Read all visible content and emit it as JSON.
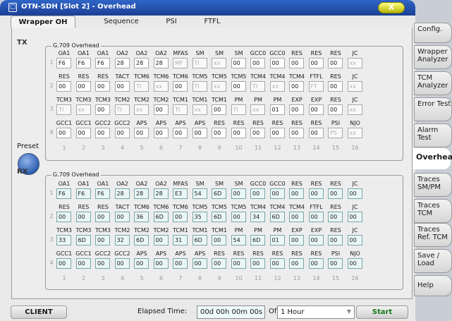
{
  "window": {
    "title": "OTN-SDH [Slot 2] - Overhead",
    "icon": "app-window-icon",
    "close_label": "X"
  },
  "tabs": [
    {
      "label": "Wrapper OH",
      "active": true
    },
    {
      "label": "Sequence"
    },
    {
      "label": "PSI"
    },
    {
      "label": "FTFL"
    }
  ],
  "tx": {
    "section_label": "TX",
    "group_label": "G.709 Overhead",
    "preset_label": "Preset",
    "rows": [
      {
        "num": "1",
        "headers": [
          "OA1",
          "OA1",
          "OA1",
          "OA2",
          "OA2",
          "OA2",
          "MFAS",
          "SM",
          "SM",
          "SM",
          "GCC0",
          "GCC0",
          "RES",
          "RES",
          "RES",
          "JC"
        ],
        "values": [
          "F6",
          "F6",
          "F6",
          "28",
          "28",
          "28",
          "MF",
          "TI",
          "xx",
          "00",
          "00",
          "00",
          "00",
          "00",
          "00",
          "xx"
        ]
      },
      {
        "num": "2",
        "headers": [
          "RES",
          "RES",
          "RES",
          "TACT",
          "TCM6",
          "TCM6",
          "TCM6",
          "TCM5",
          "TCM5",
          "TCM5",
          "TCM4",
          "TCM4",
          "TCM4",
          "FTFL",
          "RES",
          "JC"
        ],
        "values": [
          "00",
          "00",
          "00",
          "00",
          "TI",
          "xx",
          "00",
          "TI",
          "xx",
          "00",
          "TI",
          "xx",
          "00",
          "FT",
          "00",
          "xx"
        ]
      },
      {
        "num": "3",
        "headers": [
          "TCM3",
          "TCM3",
          "TCM3",
          "TCM2",
          "TCM2",
          "TCM2",
          "TCM1",
          "TCM1",
          "TCM1",
          "PM",
          "PM",
          "PM",
          "EXP",
          "EXP",
          "RES",
          "JC"
        ],
        "values": [
          "TI",
          "xx",
          "00",
          "TI",
          "xx",
          "00",
          "TI",
          "xx",
          "00",
          "TI",
          "xx",
          "01",
          "00",
          "00",
          "00",
          "xx"
        ]
      },
      {
        "num": "4",
        "headers": [
          "GCC1",
          "GCC1",
          "GCC2",
          "GCC2",
          "APS",
          "APS",
          "APS",
          "APS",
          "RES",
          "RES",
          "RES",
          "RES",
          "RES",
          "RES",
          "PSI",
          "NJO"
        ],
        "values": [
          "00",
          "00",
          "00",
          "00",
          "00",
          "00",
          "00",
          "00",
          "00",
          "00",
          "00",
          "00",
          "00",
          "00",
          "PS",
          "xx"
        ]
      }
    ],
    "disabled": [
      [
        false,
        false,
        false,
        false,
        false,
        false,
        true,
        true,
        true,
        false,
        false,
        false,
        false,
        false,
        false,
        true
      ],
      [
        false,
        false,
        false,
        false,
        true,
        true,
        false,
        true,
        true,
        false,
        true,
        true,
        false,
        true,
        false,
        true
      ],
      [
        true,
        true,
        false,
        true,
        true,
        false,
        true,
        true,
        false,
        true,
        true,
        false,
        false,
        false,
        false,
        true
      ],
      [
        false,
        false,
        false,
        false,
        false,
        false,
        false,
        false,
        false,
        false,
        false,
        false,
        false,
        false,
        true,
        true
      ]
    ],
    "col_nums": [
      "1",
      "2",
      "3",
      "4",
      "5",
      "6",
      "7",
      "8",
      "9",
      "10",
      "11",
      "12",
      "13",
      "14",
      "15",
      "16"
    ]
  },
  "rx": {
    "section_label": "RX",
    "group_label": "G.709 Overhead",
    "rows": [
      {
        "num": "1",
        "headers": [
          "OA1",
          "OA1",
          "OA1",
          "OA2",
          "OA2",
          "OA2",
          "MFAS",
          "SM",
          "SM",
          "SM",
          "GCC0",
          "GCC0",
          "RES",
          "RES",
          "RES",
          "JC"
        ],
        "values": [
          "F6",
          "F6",
          "F6",
          "28",
          "28",
          "28",
          "E3",
          "54",
          "6D",
          "00",
          "00",
          "00",
          "00",
          "00",
          "00",
          "00"
        ]
      },
      {
        "num": "2",
        "headers": [
          "RES",
          "RES",
          "RES",
          "TACT",
          "TCM6",
          "TCM6",
          "TCM6",
          "TCM5",
          "TCM5",
          "TCM5",
          "TCM4",
          "TCM4",
          "TCM4",
          "FTFL",
          "RES",
          "JC"
        ],
        "values": [
          "00",
          "00",
          "00",
          "00",
          "36",
          "6D",
          "00",
          "35",
          "6D",
          "00",
          "34",
          "6D",
          "00",
          "00",
          "00",
          "00"
        ]
      },
      {
        "num": "3",
        "headers": [
          "TCM3",
          "TCM3",
          "TCM3",
          "TCM2",
          "TCM2",
          "TCM2",
          "TCM1",
          "TCM1",
          "TCM1",
          "PM",
          "PM",
          "PM",
          "EXP",
          "EXP",
          "RES",
          "JC"
        ],
        "values": [
          "33",
          "6D",
          "00",
          "32",
          "6D",
          "00",
          "31",
          "6D",
          "00",
          "54",
          "6D",
          "01",
          "00",
          "00",
          "00",
          "00"
        ]
      },
      {
        "num": "4",
        "headers": [
          "GCC1",
          "GCC1",
          "GCC2",
          "GCC2",
          "APS",
          "APS",
          "APS",
          "APS",
          "RES",
          "RES",
          "RES",
          "RES",
          "RES",
          "RES",
          "PSI",
          "NJO"
        ],
        "values": [
          "00",
          "00",
          "00",
          "00",
          "00",
          "00",
          "00",
          "00",
          "00",
          "00",
          "00",
          "00",
          "00",
          "00",
          "00",
          "00"
        ]
      }
    ],
    "col_nums": [
      "1",
      "2",
      "3",
      "4",
      "5",
      "6",
      "7",
      "8",
      "9",
      "10",
      "11",
      "12",
      "13",
      "14",
      "15",
      "16"
    ]
  },
  "statusbar": {
    "client_label": "CLIENT",
    "elapsed_label": "Elapsed Time:",
    "elapsed_value": "00d 00h 00m 00s",
    "of_label": "Of",
    "duration_value": "1 Hour",
    "start_label": "Start"
  },
  "sidebar": [
    {
      "label": "Config."
    },
    {
      "label": "Wrapper Analyzer"
    },
    {
      "label": "TCM Analyzer"
    },
    {
      "label": "Error Test"
    },
    {
      "label": "Alarm Test"
    },
    {
      "label": "Overhead",
      "active": true
    },
    {
      "label": "Traces SM/PM"
    },
    {
      "label": "Traces TCM"
    },
    {
      "label": "Traces Ref. TCM"
    },
    {
      "label": "Save / Load"
    },
    {
      "label": "Help"
    }
  ],
  "colors": {
    "titlebar": "#1b3f93",
    "panel": "#ededed",
    "rx_cell": "#eaf6f6",
    "start_text": "#1a7a1a",
    "preset_button": "#2e5fb0"
  }
}
